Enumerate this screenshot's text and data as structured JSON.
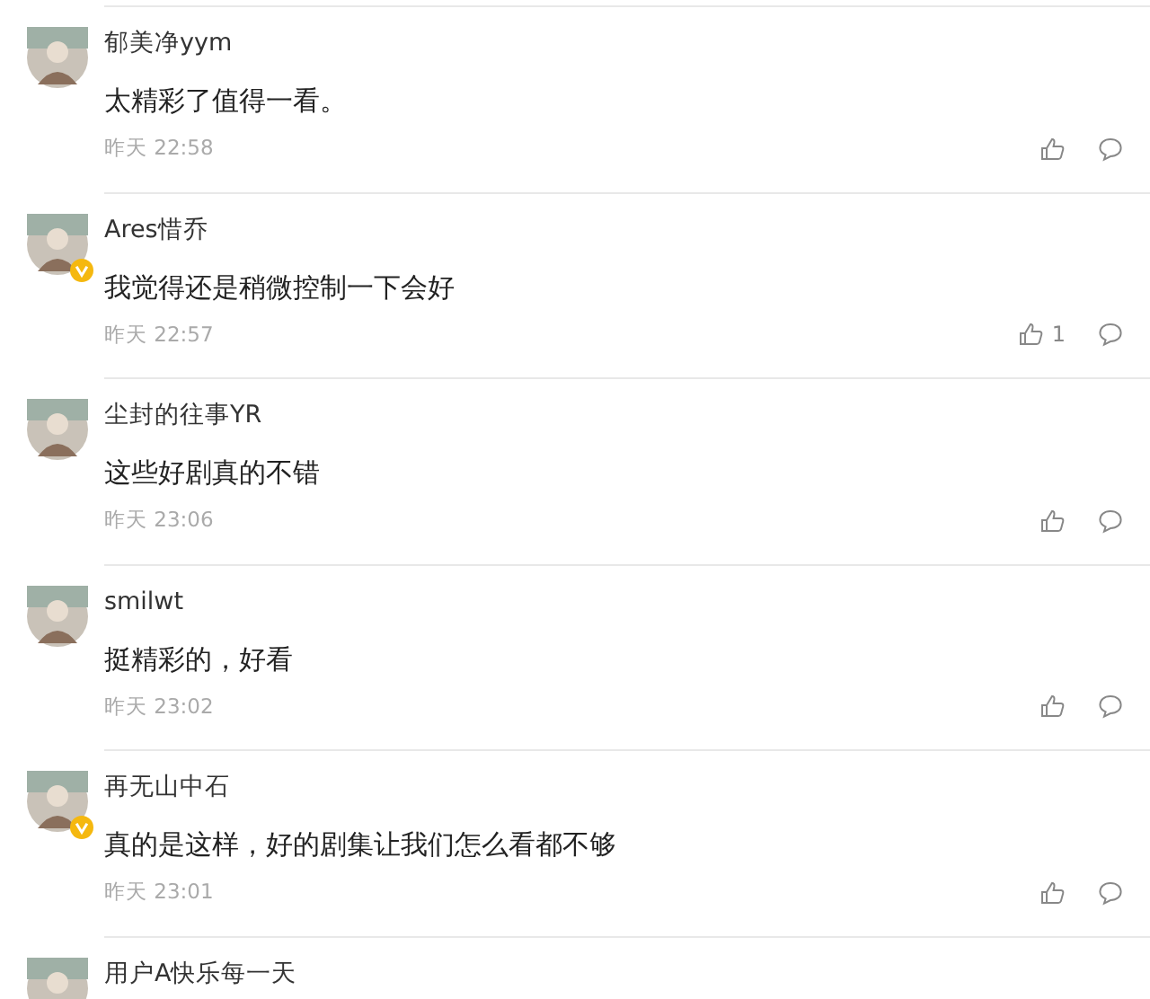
{
  "comments": [
    {
      "user": "郁美净yym",
      "verified": false,
      "text": "太精彩了值得一看。",
      "time": "昨天 22:58"
    },
    {
      "user": "Ares惜乔",
      "verified": true,
      "text": "我觉得还是稍微控制一下会好",
      "time": "昨天 22:57",
      "likes": "1"
    },
    {
      "user": "尘封的往事YR",
      "verified": false,
      "text": "这些好剧真的不错",
      "time": "昨天 23:06"
    },
    {
      "user": "smilwt",
      "verified": false,
      "text": "挺精彩的，好看",
      "time": "昨天 23:02"
    },
    {
      "user": "再无山中石",
      "verified": true,
      "text": "真的是这样，好的剧集让我们怎么看都不够",
      "time": "昨天 23:01"
    },
    {
      "user": "用户A快乐每一天"
    }
  ]
}
